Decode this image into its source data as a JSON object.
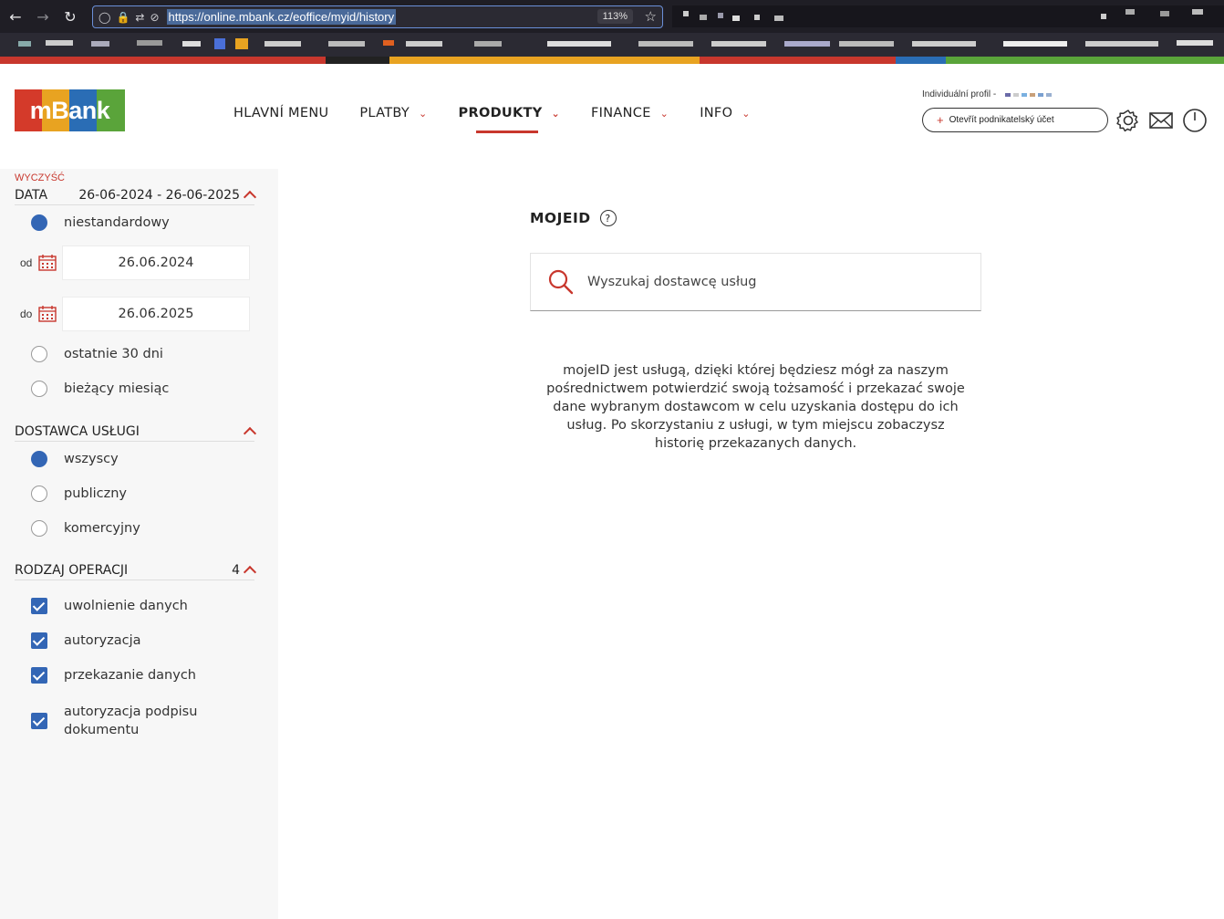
{
  "browser": {
    "url": "https://online.mbank.cz/eoffice/myid/history",
    "zoom": "113%"
  },
  "colors": {
    "accent_red": "#c8372d",
    "radio_blue": "#3366b5",
    "logo_segments": [
      "#d43a2a",
      "#e8a321",
      "#2a6db5",
      "#5aa43a"
    ]
  },
  "header": {
    "logo": "mBank",
    "nav": [
      {
        "label": "HLAVNÍ MENU",
        "has_dropdown": false
      },
      {
        "label": "PLATBY",
        "has_dropdown": true
      },
      {
        "label": "PRODUKTY",
        "has_dropdown": true,
        "active": true
      },
      {
        "label": "FINANCE",
        "has_dropdown": true
      },
      {
        "label": "INFO",
        "has_dropdown": true
      }
    ],
    "profile_label": "Individuální profil -",
    "open_account_label": "Otevřít podnikatelský účet",
    "icons": [
      "settings-icon",
      "mail-icon",
      "power-icon"
    ]
  },
  "sidebar": {
    "clear_label": "WYCZYŚĆ",
    "date": {
      "title": "DATA",
      "range": "26-06-2024 - 26-06-2025",
      "opt_custom": "niestandardowy",
      "from_label": "od",
      "from_value": "26.06.2024",
      "to_label": "do",
      "to_value": "26.06.2025",
      "opt_30": "ostatnie 30 dni",
      "opt_month": "bieżący miesiąc"
    },
    "provider": {
      "title": "DOSTAWCA USŁUGI",
      "opt_all": "wszyscy",
      "opt_public": "publiczny",
      "opt_commercial": "komercyjny"
    },
    "operation": {
      "title": "RODZAJ OPERACJI",
      "count": "4",
      "opt1": "uwolnienie danych",
      "opt2": "autoryzacja",
      "opt3": "przekazanie danych",
      "opt4_line1": "autoryzacja podpisu",
      "opt4_line2": "dokumentu"
    }
  },
  "main": {
    "title": "MOJEID",
    "search_placeholder": "Wyszukaj dostawcę usług",
    "description": "mojeID jest usługą, dzięki której będziesz mógł za naszym pośrednictwem potwierdzić swoją tożsamość i przekazać swoje dane wybranym dostawcom w celu uzyskania dostępu do ich usług. Po skorzystaniu z usługi, w tym miejscu zobaczysz historię przekazanych danych."
  }
}
